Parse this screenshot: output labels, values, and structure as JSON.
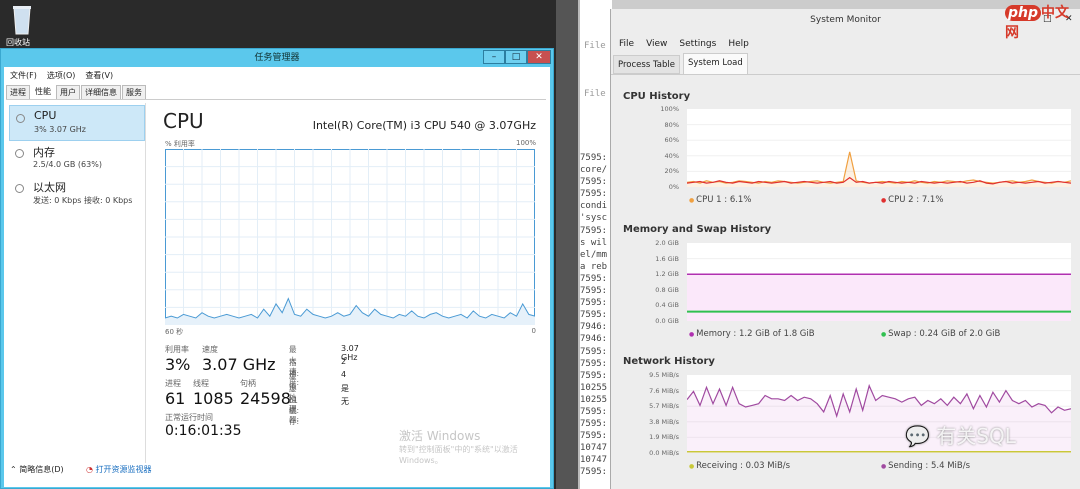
{
  "desktop": {
    "recycle_bin_label": "回收站"
  },
  "task_manager": {
    "title": "任务管理器",
    "window_buttons": {
      "minimize": "–",
      "maximize": "□",
      "close": "✕"
    },
    "menu": [
      "文件(F)",
      "选项(O)",
      "查看(V)"
    ],
    "tabs": [
      "进程",
      "性能",
      "用户",
      "详细信息",
      "服务"
    ],
    "active_tab": "性能",
    "resources": [
      {
        "name": "CPU",
        "sub": "3% 3.07 GHz"
      },
      {
        "name": "内存",
        "sub": "2.5/4.0 GB (63%)"
      },
      {
        "name": "以太网",
        "sub": "发送: 0 Kbps 接收: 0 Kbps"
      }
    ],
    "heading": "CPU",
    "cpu_model": "Intel(R) Core(TM) i3 CPU 540 @ 3.07GHz",
    "graph_label": "% 利用率",
    "graph_max": "100%",
    "graph_time": "60 秒",
    "graph_min": "0",
    "graph_values": [
      4,
      5,
      4,
      6,
      5,
      4,
      7,
      5,
      4,
      5,
      6,
      5,
      4,
      5,
      6,
      4,
      9,
      5,
      12,
      7,
      15,
      6,
      5,
      9,
      6,
      5,
      4,
      5,
      7,
      5,
      6,
      11,
      7,
      5,
      9,
      6,
      5,
      4,
      6,
      5,
      8,
      5,
      4,
      6,
      7,
      5,
      4,
      5,
      6,
      4,
      8,
      5,
      4,
      6,
      5,
      4,
      7,
      5,
      12,
      6,
      5
    ],
    "stats": {
      "util_label": "利用率",
      "util": "3%",
      "speed_label": "速度",
      "speed": "3.07 GHz",
      "proc_label": "进程",
      "proc": "61",
      "thread_label": "线程",
      "thread": "1085",
      "handle_label": "句柄",
      "handle": "24598",
      "uptime_label": "正常运行时间",
      "uptime": "0:16:01:35"
    },
    "specs": [
      {
        "k": "最大速度:",
        "v": "3.07 GHz"
      },
      {
        "k": "插槽:",
        "v": "2"
      },
      {
        "k": "虚拟处理器:",
        "v": "4"
      },
      {
        "k": "虚拟机:",
        "v": "是"
      },
      {
        "k": "L1 缓存:",
        "v": "无"
      }
    ],
    "activation": [
      "激活 Windows",
      "转到\"控制面板\"中的\"系统\"以激活",
      "Windows。"
    ],
    "footer": {
      "less": "简略信息(D)",
      "monitor": "打开资源监视器"
    }
  },
  "terminal": {
    "lines": [
      "7595:",
      "core/",
      "7595:",
      "7595:",
      "condi",
      "'sysc",
      "7595:",
      "s wil",
      "el/mm",
      "a reb",
      "7595:",
      "7595:",
      "7595:",
      "7595:",
      "7946:",
      "7946:",
      "7595:",
      "7595:",
      "7595:",
      "10255",
      "10255",
      "7595:",
      "7595:",
      "7595:",
      "10747",
      "10747",
      "7595:"
    ]
  },
  "bg_windows": {
    "file1": "File",
    "file2": "File"
  },
  "system_monitor": {
    "title": "System Monitor",
    "window_buttons": {
      "minimize": "–",
      "maximize": "□",
      "close": "✕"
    },
    "menu": [
      "File",
      "View",
      "Settings",
      "Help"
    ],
    "tabs": [
      "Process Table",
      "System Load"
    ],
    "active_tab": "System Load",
    "cpu": {
      "title": "CPU History",
      "ticks": [
        "100%",
        "80%",
        "60%",
        "40%",
        "20%",
        "0%"
      ],
      "legend": [
        {
          "label": "CPU 1 : 6.1%",
          "color": "#f0a040"
        },
        {
          "label": "CPU 2 : 7.1%",
          "color": "#e03030"
        }
      ],
      "cpu1": [
        6,
        7,
        5,
        8,
        6,
        7,
        5,
        6,
        8,
        7,
        6,
        5,
        7,
        6,
        8,
        7,
        6,
        5,
        6,
        7,
        8,
        6,
        5,
        6,
        7,
        45,
        8,
        6,
        5,
        6,
        7,
        6,
        5,
        7,
        6,
        8,
        6,
        5,
        7,
        6,
        8,
        7,
        6,
        8,
        9,
        7,
        6,
        5,
        6,
        7,
        8,
        6,
        7,
        9,
        7,
        6,
        5,
        7,
        6,
        8
      ],
      "cpu2": [
        5,
        6,
        7,
        5,
        6,
        8,
        6,
        5,
        7,
        6,
        5,
        7,
        6,
        5,
        6,
        7,
        5,
        6,
        7,
        6,
        5,
        6,
        7,
        5,
        6,
        12,
        6,
        7,
        5,
        6,
        5,
        7,
        6,
        5,
        6,
        5,
        7,
        6,
        5,
        6,
        5,
        6,
        7,
        5,
        6,
        8,
        5,
        4,
        6,
        7,
        5,
        6,
        5,
        6,
        7,
        5,
        6,
        7,
        6,
        5
      ]
    },
    "memory": {
      "title": "Memory and Swap History",
      "ticks": [
        "2.0 GiB",
        "1.6 GiB",
        "1.2 GiB",
        "0.8 GiB",
        "0.4 GiB",
        "0.0 GiB"
      ],
      "memory_gib": 1.2,
      "swap_gib": 0.24,
      "legend": [
        {
          "label": "Memory : 1.2 GiB of 1.8 GiB",
          "color": "#b030b0"
        },
        {
          "label": "Swap : 0.24 GiB of 2.0 GiB",
          "color": "#30c050"
        }
      ]
    },
    "network": {
      "title": "Network History",
      "ticks": [
        "9.5 MiB/s",
        "7.6 MiB/s",
        "5.7 MiB/s",
        "3.8 MiB/s",
        "1.9 MiB/s",
        "0.0 MiB/s"
      ],
      "sending": [
        6.5,
        7.5,
        5.8,
        8,
        6,
        7.8,
        5.8,
        8,
        6,
        5.6,
        5.8,
        6,
        7,
        6.6,
        6.6,
        6.4,
        7,
        6.4,
        6.8,
        6.6,
        6,
        5,
        7,
        4.5,
        7.2,
        5,
        7.8,
        5.2,
        8.2,
        6.4,
        7,
        6.8,
        6.6,
        6.2,
        6.6,
        6.8,
        5.8,
        6.4,
        6,
        6.6,
        5.8,
        6.8,
        6,
        7.2,
        5.4,
        7,
        5.6,
        7.4,
        6.2,
        7.6,
        6.4,
        6,
        6.4,
        5.6,
        6,
        5.8,
        4.9,
        5.6,
        5.2,
        5.4
      ],
      "receiving": [
        0.03
      ],
      "legend": [
        {
          "label": "Receiving : 0.03 MiB/s",
          "color": "#c8c838"
        },
        {
          "label": "Sending : 5.4 MiB/s",
          "color": "#a04aa0"
        }
      ]
    }
  },
  "watermarks": {
    "php": "php中文网",
    "wechat": "有关SQL"
  }
}
